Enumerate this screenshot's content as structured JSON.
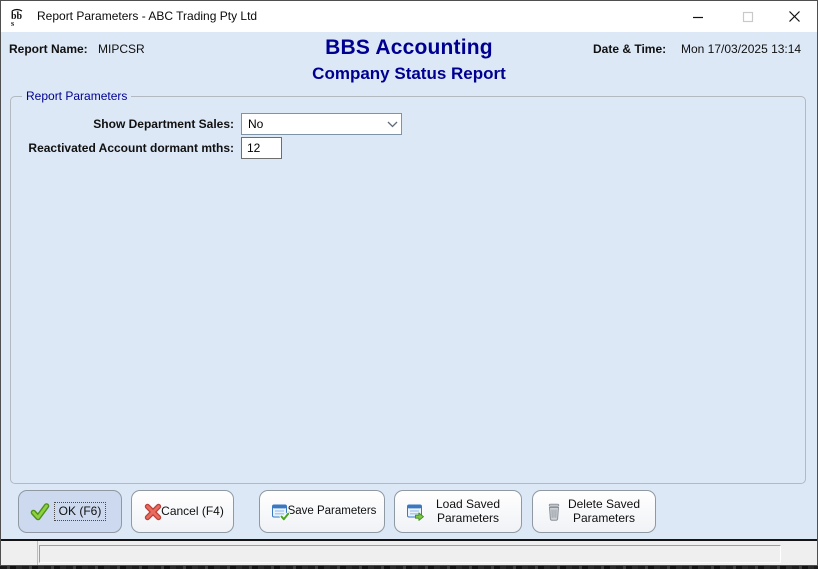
{
  "window": {
    "title": "Report Parameters - ABC Trading Pty Ltd",
    "app_icon": "bbs-logo"
  },
  "header": {
    "report_name_label": "Report Name:",
    "report_name_value": "MIPCSR",
    "app_title": "BBS Accounting",
    "report_title": "Company Status Report",
    "datetime_label": "Date & Time:",
    "datetime_value": "Mon 17/03/2025 13:14"
  },
  "parameters": {
    "group_label": "Report Parameters",
    "fields": [
      {
        "label": "Show Department Sales:",
        "type": "select",
        "value": "No"
      },
      {
        "label": "Reactivated Account dormant mths:",
        "type": "text",
        "value": "12"
      }
    ]
  },
  "buttons": [
    {
      "label": "OK (F6)",
      "icon": "check-icon",
      "focused": true
    },
    {
      "label": "Cancel (F4)",
      "icon": "cancel-icon",
      "focused": false
    },
    {
      "label": "Save Parameters",
      "icon": "save-parameters-icon",
      "focused": false
    },
    {
      "label": "Load Saved Parameters",
      "icon": "load-parameters-icon",
      "focused": false
    },
    {
      "label": "Delete Saved Parameters",
      "icon": "delete-parameters-icon",
      "focused": false
    }
  ],
  "statusbar": {
    "message": ""
  },
  "colors": {
    "window_background": "#dce8f6",
    "titlebar_background": "#ffffff",
    "heading_navy": "#000090",
    "ok_button_highlight": "#ccd9ee",
    "check_green": "#6db52c",
    "cancel_red": "#e2574c",
    "icon_blue": "#3a78c2",
    "statusbar_gray": "#efefef"
  }
}
